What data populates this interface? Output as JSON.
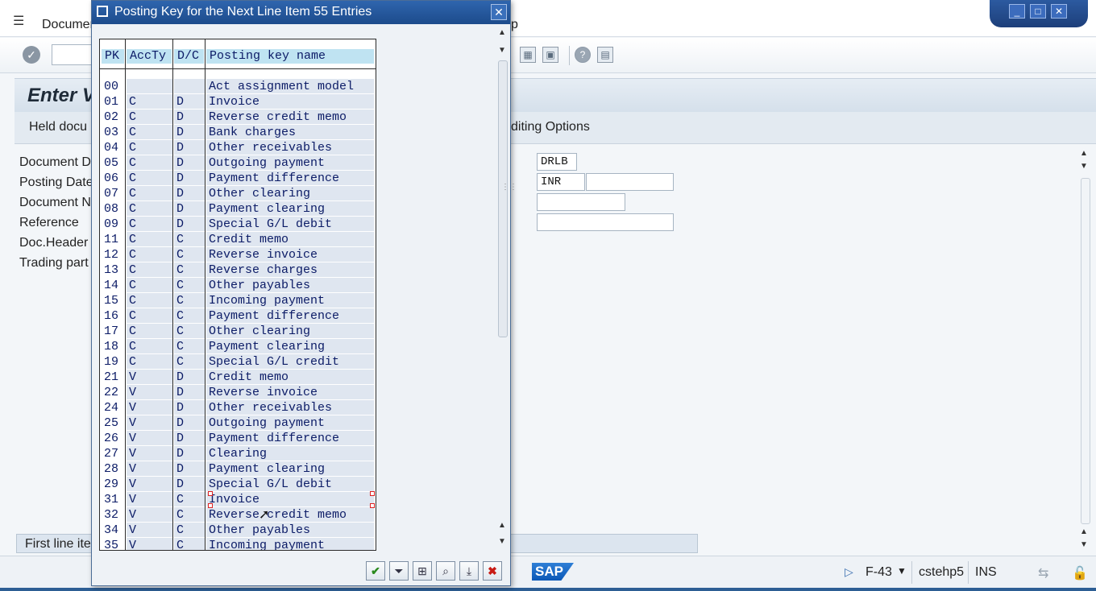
{
  "menu": {
    "document": "Documer",
    "help_fragment": "p"
  },
  "screen": {
    "title_fragment": "Enter V"
  },
  "appbar": {
    "held_label": "Held docu",
    "editing_label": "diting Options"
  },
  "form": {
    "labels": [
      "Document D",
      "Posting Date",
      "Document N",
      "Reference",
      "Doc.Header",
      "Trading part"
    ],
    "company_code": "DRLB",
    "currency": "INR",
    "first_line": "First line ite"
  },
  "status": {
    "logo": "SAP",
    "transaction": "F-43",
    "system": "cstehp5",
    "mode": "INS"
  },
  "dialog": {
    "title": "Posting Key for the Next Line Item 55 Entries",
    "columns": [
      "PK",
      "AccTy",
      "D/C",
      "Posting key name"
    ],
    "rows": [
      {
        "pk": "00",
        "acc": "",
        "dc": "",
        "name": "Act assignment model"
      },
      {
        "pk": "01",
        "acc": "C",
        "dc": "D",
        "name": "Invoice"
      },
      {
        "pk": "02",
        "acc": "C",
        "dc": "D",
        "name": "Reverse credit memo"
      },
      {
        "pk": "03",
        "acc": "C",
        "dc": "D",
        "name": "Bank charges"
      },
      {
        "pk": "04",
        "acc": "C",
        "dc": "D",
        "name": "Other receivables"
      },
      {
        "pk": "05",
        "acc": "C",
        "dc": "D",
        "name": "Outgoing payment"
      },
      {
        "pk": "06",
        "acc": "C",
        "dc": "D",
        "name": "Payment difference"
      },
      {
        "pk": "07",
        "acc": "C",
        "dc": "D",
        "name": "Other clearing"
      },
      {
        "pk": "08",
        "acc": "C",
        "dc": "D",
        "name": "Payment clearing"
      },
      {
        "pk": "09",
        "acc": "C",
        "dc": "D",
        "name": "Special G/L debit"
      },
      {
        "pk": "11",
        "acc": "C",
        "dc": "C",
        "name": "Credit memo"
      },
      {
        "pk": "12",
        "acc": "C",
        "dc": "C",
        "name": "Reverse invoice"
      },
      {
        "pk": "13",
        "acc": "C",
        "dc": "C",
        "name": "Reverse charges"
      },
      {
        "pk": "14",
        "acc": "C",
        "dc": "C",
        "name": "Other payables"
      },
      {
        "pk": "15",
        "acc": "C",
        "dc": "C",
        "name": "Incoming payment"
      },
      {
        "pk": "16",
        "acc": "C",
        "dc": "C",
        "name": "Payment difference"
      },
      {
        "pk": "17",
        "acc": "C",
        "dc": "C",
        "name": "Other clearing"
      },
      {
        "pk": "18",
        "acc": "C",
        "dc": "C",
        "name": "Payment clearing"
      },
      {
        "pk": "19",
        "acc": "C",
        "dc": "C",
        "name": "Special G/L credit"
      },
      {
        "pk": "21",
        "acc": "V",
        "dc": "D",
        "name": "Credit memo"
      },
      {
        "pk": "22",
        "acc": "V",
        "dc": "D",
        "name": "Reverse invoice"
      },
      {
        "pk": "24",
        "acc": "V",
        "dc": "D",
        "name": "Other receivables"
      },
      {
        "pk": "25",
        "acc": "V",
        "dc": "D",
        "name": "Outgoing payment"
      },
      {
        "pk": "26",
        "acc": "V",
        "dc": "D",
        "name": "Payment difference"
      },
      {
        "pk": "27",
        "acc": "V",
        "dc": "D",
        "name": "Clearing"
      },
      {
        "pk": "28",
        "acc": "V",
        "dc": "D",
        "name": "Payment clearing"
      },
      {
        "pk": "29",
        "acc": "V",
        "dc": "D",
        "name": "Special G/L debit"
      },
      {
        "pk": "31",
        "acc": "V",
        "dc": "C",
        "name": "Invoice"
      },
      {
        "pk": "32",
        "acc": "V",
        "dc": "C",
        "name": "Reverse credit memo"
      },
      {
        "pk": "34",
        "acc": "V",
        "dc": "C",
        "name": "Other payables"
      },
      {
        "pk": "35",
        "acc": "V",
        "dc": "C",
        "name": "Incoming payment"
      }
    ]
  }
}
